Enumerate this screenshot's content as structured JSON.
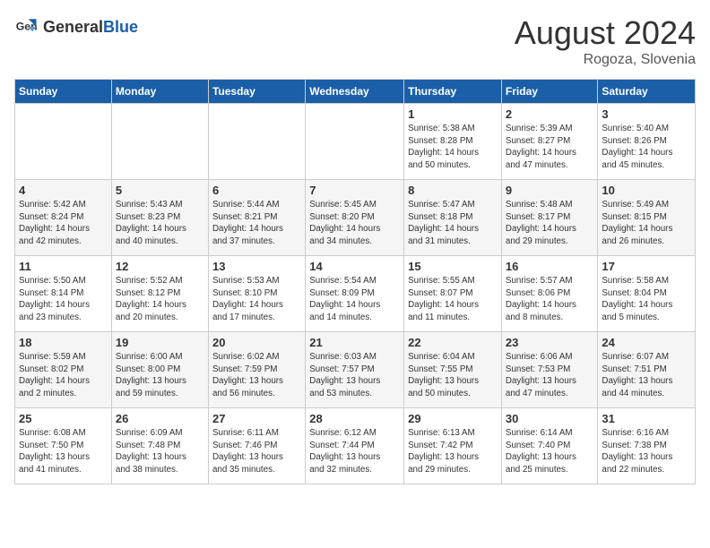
{
  "header": {
    "logo_general": "General",
    "logo_blue": "Blue",
    "month_year": "August 2024",
    "location": "Rogoza, Slovenia"
  },
  "weekdays": [
    "Sunday",
    "Monday",
    "Tuesday",
    "Wednesday",
    "Thursday",
    "Friday",
    "Saturday"
  ],
  "weeks": [
    [
      {
        "day": "",
        "info": ""
      },
      {
        "day": "",
        "info": ""
      },
      {
        "day": "",
        "info": ""
      },
      {
        "day": "",
        "info": ""
      },
      {
        "day": "1",
        "info": "Sunrise: 5:38 AM\nSunset: 8:28 PM\nDaylight: 14 hours\nand 50 minutes."
      },
      {
        "day": "2",
        "info": "Sunrise: 5:39 AM\nSunset: 8:27 PM\nDaylight: 14 hours\nand 47 minutes."
      },
      {
        "day": "3",
        "info": "Sunrise: 5:40 AM\nSunset: 8:26 PM\nDaylight: 14 hours\nand 45 minutes."
      }
    ],
    [
      {
        "day": "4",
        "info": "Sunrise: 5:42 AM\nSunset: 8:24 PM\nDaylight: 14 hours\nand 42 minutes."
      },
      {
        "day": "5",
        "info": "Sunrise: 5:43 AM\nSunset: 8:23 PM\nDaylight: 14 hours\nand 40 minutes."
      },
      {
        "day": "6",
        "info": "Sunrise: 5:44 AM\nSunset: 8:21 PM\nDaylight: 14 hours\nand 37 minutes."
      },
      {
        "day": "7",
        "info": "Sunrise: 5:45 AM\nSunset: 8:20 PM\nDaylight: 14 hours\nand 34 minutes."
      },
      {
        "day": "8",
        "info": "Sunrise: 5:47 AM\nSunset: 8:18 PM\nDaylight: 14 hours\nand 31 minutes."
      },
      {
        "day": "9",
        "info": "Sunrise: 5:48 AM\nSunset: 8:17 PM\nDaylight: 14 hours\nand 29 minutes."
      },
      {
        "day": "10",
        "info": "Sunrise: 5:49 AM\nSunset: 8:15 PM\nDaylight: 14 hours\nand 26 minutes."
      }
    ],
    [
      {
        "day": "11",
        "info": "Sunrise: 5:50 AM\nSunset: 8:14 PM\nDaylight: 14 hours\nand 23 minutes."
      },
      {
        "day": "12",
        "info": "Sunrise: 5:52 AM\nSunset: 8:12 PM\nDaylight: 14 hours\nand 20 minutes."
      },
      {
        "day": "13",
        "info": "Sunrise: 5:53 AM\nSunset: 8:10 PM\nDaylight: 14 hours\nand 17 minutes."
      },
      {
        "day": "14",
        "info": "Sunrise: 5:54 AM\nSunset: 8:09 PM\nDaylight: 14 hours\nand 14 minutes."
      },
      {
        "day": "15",
        "info": "Sunrise: 5:55 AM\nSunset: 8:07 PM\nDaylight: 14 hours\nand 11 minutes."
      },
      {
        "day": "16",
        "info": "Sunrise: 5:57 AM\nSunset: 8:06 PM\nDaylight: 14 hours\nand 8 minutes."
      },
      {
        "day": "17",
        "info": "Sunrise: 5:58 AM\nSunset: 8:04 PM\nDaylight: 14 hours\nand 5 minutes."
      }
    ],
    [
      {
        "day": "18",
        "info": "Sunrise: 5:59 AM\nSunset: 8:02 PM\nDaylight: 14 hours\nand 2 minutes."
      },
      {
        "day": "19",
        "info": "Sunrise: 6:00 AM\nSunset: 8:00 PM\nDaylight: 13 hours\nand 59 minutes."
      },
      {
        "day": "20",
        "info": "Sunrise: 6:02 AM\nSunset: 7:59 PM\nDaylight: 13 hours\nand 56 minutes."
      },
      {
        "day": "21",
        "info": "Sunrise: 6:03 AM\nSunset: 7:57 PM\nDaylight: 13 hours\nand 53 minutes."
      },
      {
        "day": "22",
        "info": "Sunrise: 6:04 AM\nSunset: 7:55 PM\nDaylight: 13 hours\nand 50 minutes."
      },
      {
        "day": "23",
        "info": "Sunrise: 6:06 AM\nSunset: 7:53 PM\nDaylight: 13 hours\nand 47 minutes."
      },
      {
        "day": "24",
        "info": "Sunrise: 6:07 AM\nSunset: 7:51 PM\nDaylight: 13 hours\nand 44 minutes."
      }
    ],
    [
      {
        "day": "25",
        "info": "Sunrise: 6:08 AM\nSunset: 7:50 PM\nDaylight: 13 hours\nand 41 minutes."
      },
      {
        "day": "26",
        "info": "Sunrise: 6:09 AM\nSunset: 7:48 PM\nDaylight: 13 hours\nand 38 minutes."
      },
      {
        "day": "27",
        "info": "Sunrise: 6:11 AM\nSunset: 7:46 PM\nDaylight: 13 hours\nand 35 minutes."
      },
      {
        "day": "28",
        "info": "Sunrise: 6:12 AM\nSunset: 7:44 PM\nDaylight: 13 hours\nand 32 minutes."
      },
      {
        "day": "29",
        "info": "Sunrise: 6:13 AM\nSunset: 7:42 PM\nDaylight: 13 hours\nand 29 minutes."
      },
      {
        "day": "30",
        "info": "Sunrise: 6:14 AM\nSunset: 7:40 PM\nDaylight: 13 hours\nand 25 minutes."
      },
      {
        "day": "31",
        "info": "Sunrise: 6:16 AM\nSunset: 7:38 PM\nDaylight: 13 hours\nand 22 minutes."
      }
    ]
  ]
}
